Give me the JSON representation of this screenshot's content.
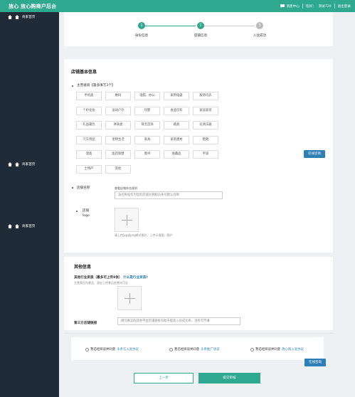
{
  "header": {
    "brand": "放心 放心购商户后台",
    "messages": "消息中心",
    "user_label": "您好：",
    "user_name": "测试720",
    "logout": "退出登录"
  },
  "sidebar": {
    "items": [
      {
        "label": "商家首页"
      },
      {
        "label": "商家首页"
      },
      {
        "label": "商家首页"
      }
    ]
  },
  "steps": [
    {
      "num": "1",
      "label": "身份信息"
    },
    {
      "num": "2",
      "label": "店铺信息"
    },
    {
      "num": "3",
      "label": "入驻成功"
    }
  ],
  "store_basic": {
    "title": "店铺基本信息",
    "category_label": "主营类目【最多填写3个】",
    "categories": [
      [
        "手机类",
        "数码",
        "电脑、办公",
        "家用电器",
        "服饰内衣"
      ],
      [
        "个护化妆",
        "运动户外",
        "母婴",
        "食品饮料",
        "家居家装"
      ],
      [
        "礼品箱包",
        "钟表类",
        "珠宝首饰",
        "箱具",
        "玩具乐器"
      ],
      [
        "汽车用品",
        "宠物生活",
        "家具",
        "家装建材",
        "鞋靴"
      ],
      [
        "酒类",
        "医药保健",
        "图书",
        "收藏品",
        "宇波"
      ],
      [
        "土特产",
        "其他"
      ]
    ],
    "online_consult": "在线咨询",
    "store_name_label": "店铺名称",
    "store_name_hint": "查看店铺命名规则",
    "store_name_placeholder": "该名称会作为您的店铺名称和头条号默认名称",
    "logo_label_1": "店铺",
    "logo_label_2": "logo",
    "logo_hint_prefix": "请上传jpg或png格式图片，上传示意图",
    "logo_hint_link": "（图片"
  },
  "other_info": {
    "title": "其他信息",
    "qualification_label": "其他行业资质（最多可上传8张）",
    "qualification_link": "什么是行业资质?",
    "qualification_sub": "主营类目为食品、酒业上传食品经营许可证",
    "third_party_label": "第三方店铺链接",
    "third_party_placeholder": "填写真实的其他平台店铺链接有助于提高入驻成功率，没有可不填"
  },
  "agreements": [
    {
      "prefix": "我已经阅读并同意",
      "link": "头条号入驻协议"
    },
    {
      "prefix": "我已经阅读并同意",
      "link": "头条推广协议"
    },
    {
      "prefix": "我已经阅读并同意",
      "link": "放心购入驻协议"
    }
  ],
  "actions": {
    "online_consult": "在线咨询",
    "prev": "上一步",
    "submit": "提交审核"
  },
  "colors": {
    "primary": "#2fa890",
    "sidebar": "#1f2b36",
    "link": "#2d7fb8"
  }
}
